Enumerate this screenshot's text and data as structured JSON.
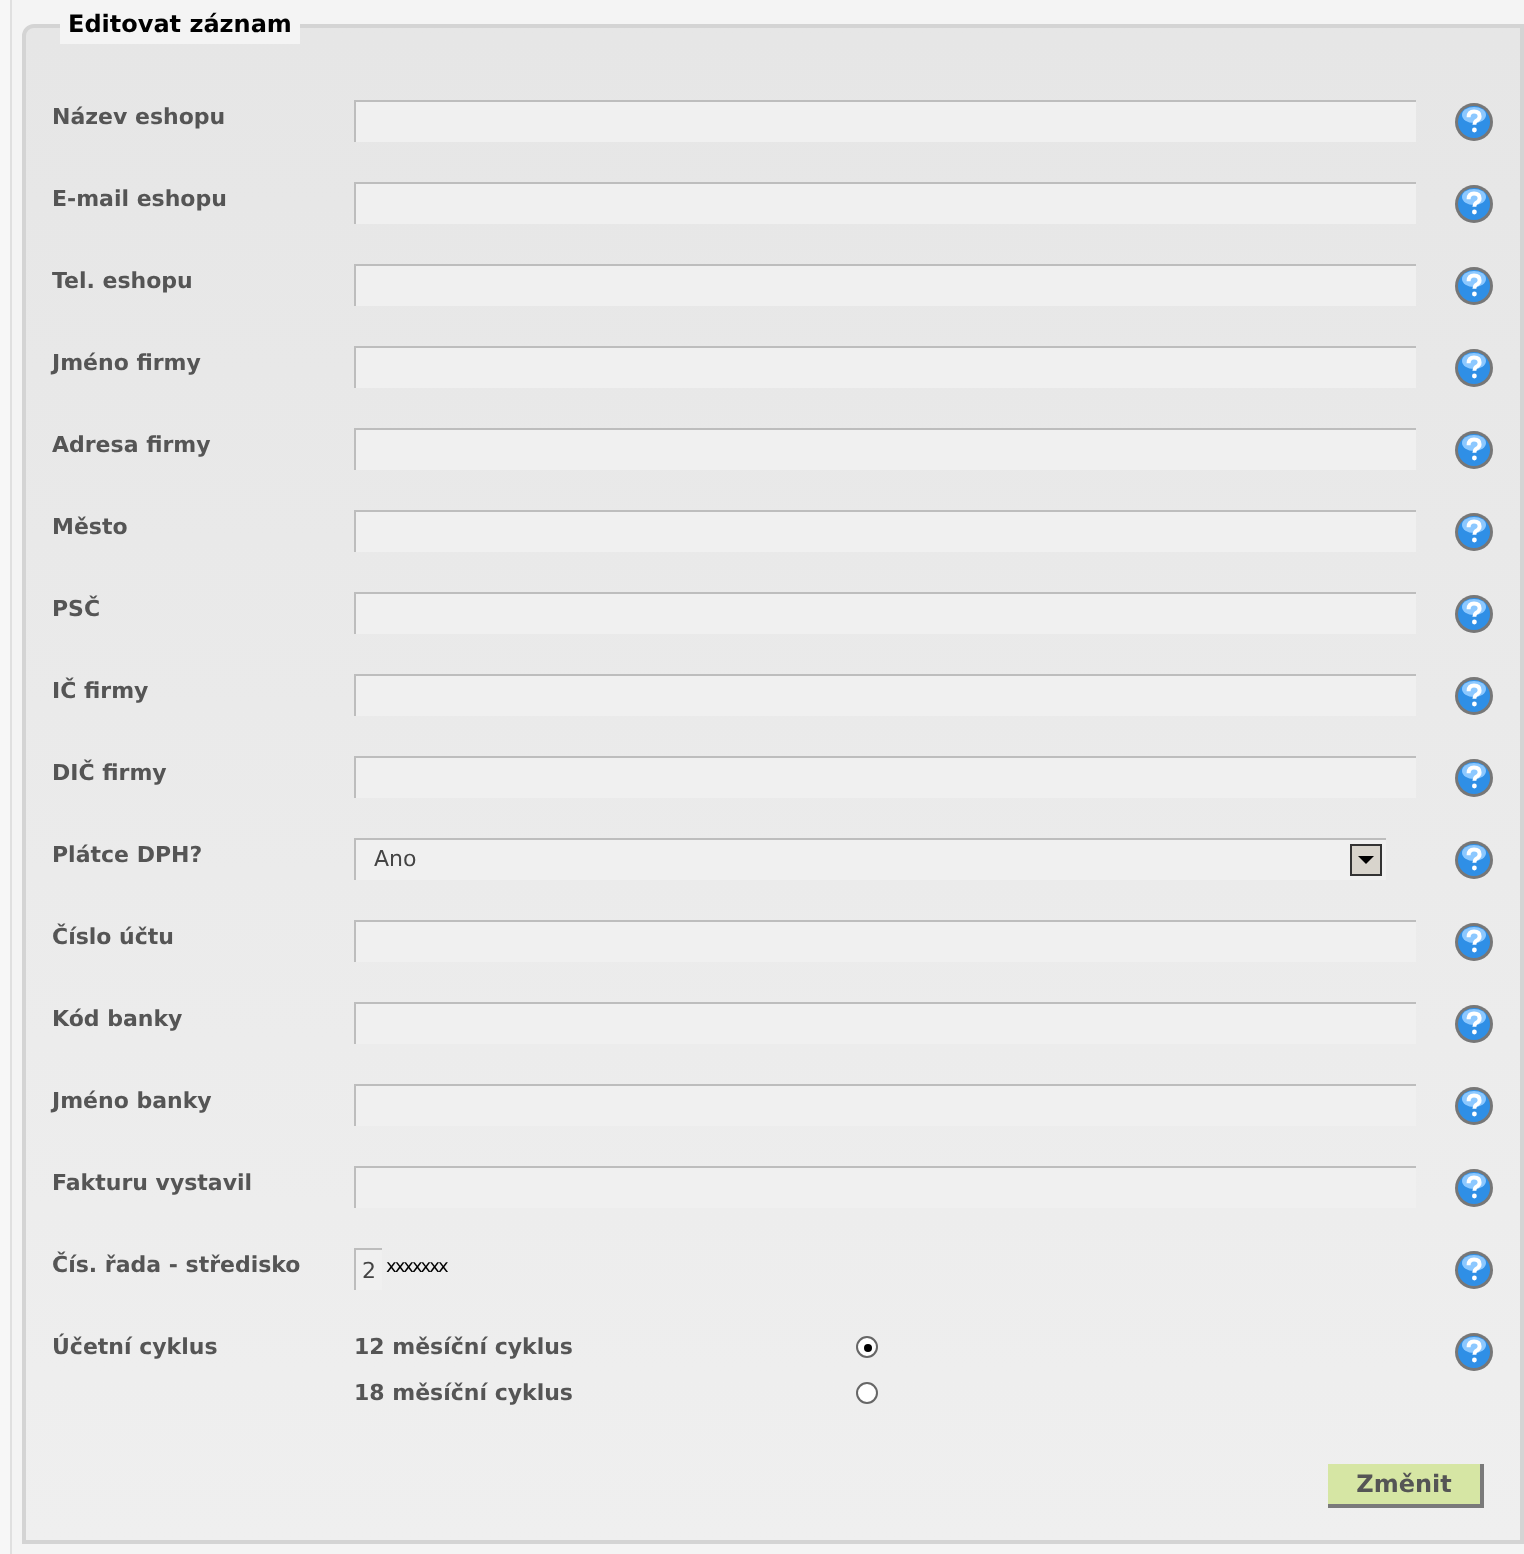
{
  "legend": "Editovat záznam",
  "rows": [
    {
      "label": "Název eshopu",
      "kind": "text"
    },
    {
      "label": "E-mail eshopu",
      "kind": "text"
    },
    {
      "label": "Tel. eshopu",
      "kind": "text"
    },
    {
      "label": "Jméno firmy",
      "kind": "text"
    },
    {
      "label": "Adresa firmy",
      "kind": "text"
    },
    {
      "label": "Město",
      "kind": "text"
    },
    {
      "label": "PSČ",
      "kind": "text"
    },
    {
      "label": "IČ firmy",
      "kind": "text"
    },
    {
      "label": "DIČ firmy",
      "kind": "text"
    },
    {
      "label": "Plátce DPH?",
      "kind": "select",
      "value": "Ano"
    },
    {
      "label": "Číslo účtu",
      "kind": "text"
    },
    {
      "label": "Kód banky",
      "kind": "text"
    },
    {
      "label": "Jméno banky",
      "kind": "text"
    },
    {
      "label": "Fakturu vystavil",
      "kind": "text"
    },
    {
      "label": "Čís. řada - středisko",
      "kind": "code",
      "value": "2",
      "suffix": "xxxxxxx"
    },
    {
      "label": "Účetní cyklus",
      "kind": "radio",
      "options": [
        {
          "label": "12 měsíční cyklus",
          "selected": true
        },
        {
          "label": "18 měsíční cyklus",
          "selected": false
        }
      ]
    }
  ],
  "submit": "Změnit"
}
